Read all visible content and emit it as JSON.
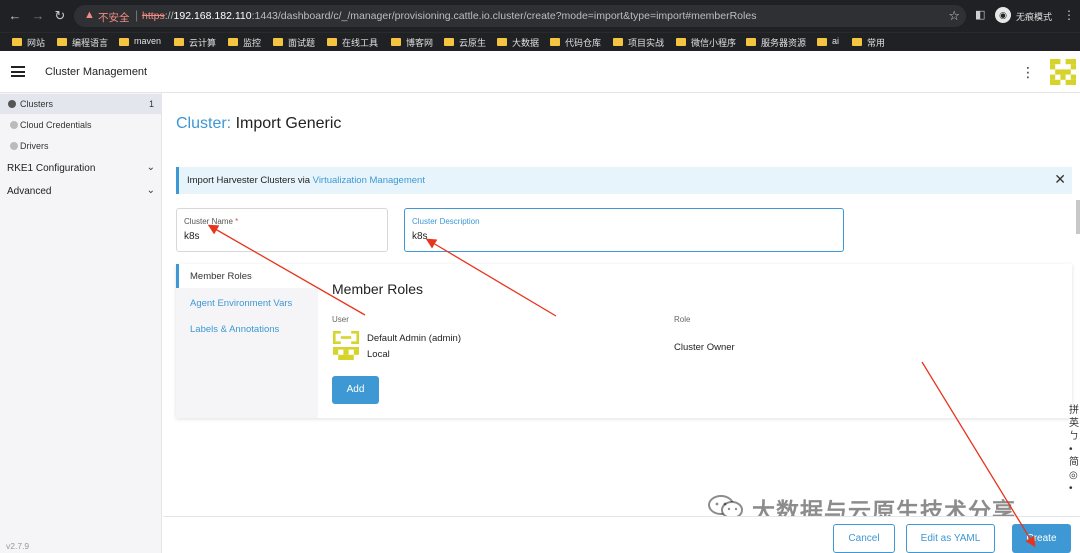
{
  "browser": {
    "insecure_label": "不安全",
    "url_scheme": "https",
    "url_host": "192.168.182.110",
    "url_rest": ":1443/dashboard/c/_/manager/provisioning.cattle.io.cluster/create?mode=import&type=import#memberRoles",
    "incognito_label": "无痕模式",
    "bookmarks": [
      "网站",
      "编程语言",
      "maven",
      "云计算",
      "监控",
      "面试题",
      "在线工具",
      "博客网",
      "云原生",
      "大数据",
      "代码仓库",
      "项目实战",
      "微信小程序",
      "服务器资源",
      "ai",
      "常用"
    ]
  },
  "header": {
    "title": "Cluster Management"
  },
  "sidebar": {
    "items": [
      {
        "label": "Clusters",
        "count": "1"
      },
      {
        "label": "Cloud Credentials"
      },
      {
        "label": "Drivers"
      }
    ],
    "groups": [
      {
        "label": "RKE1 Configuration"
      },
      {
        "label": "Advanced"
      }
    ],
    "version": "v2.7.9"
  },
  "page": {
    "title_prefix": "Cluster:",
    "title_main": "Import Generic"
  },
  "banner": {
    "text": "Import Harvester Clusters via ",
    "link": "Virtualization Management"
  },
  "form": {
    "name_label": "Cluster Name",
    "name_required": "*",
    "name_value": "k8s",
    "desc_label": "Cluster Description",
    "desc_value": "k8s"
  },
  "tabs": [
    {
      "label": "Member Roles"
    },
    {
      "label": "Agent Environment Vars"
    },
    {
      "label": "Labels & Annotations"
    }
  ],
  "member_roles": {
    "title": "Member Roles",
    "user_header": "User",
    "role_header": "Role",
    "user_name": "Default Admin (admin)",
    "user_sub": "Local",
    "role": "Cluster Owner",
    "add_label": "Add"
  },
  "ime_chars": [
    "拼",
    "英",
    "ㄅ",
    "•",
    "简",
    "◎",
    "•"
  ],
  "watermark": {
    "text": "大数据与云原生技术分享"
  },
  "footer": {
    "cancel_label": "Cancel",
    "yaml_label": "Edit as YAML",
    "create_label": "Create"
  },
  "colors": {
    "accent": "#3d98d3",
    "avatar": "#d6d42a",
    "arrow": "#e8341c"
  }
}
